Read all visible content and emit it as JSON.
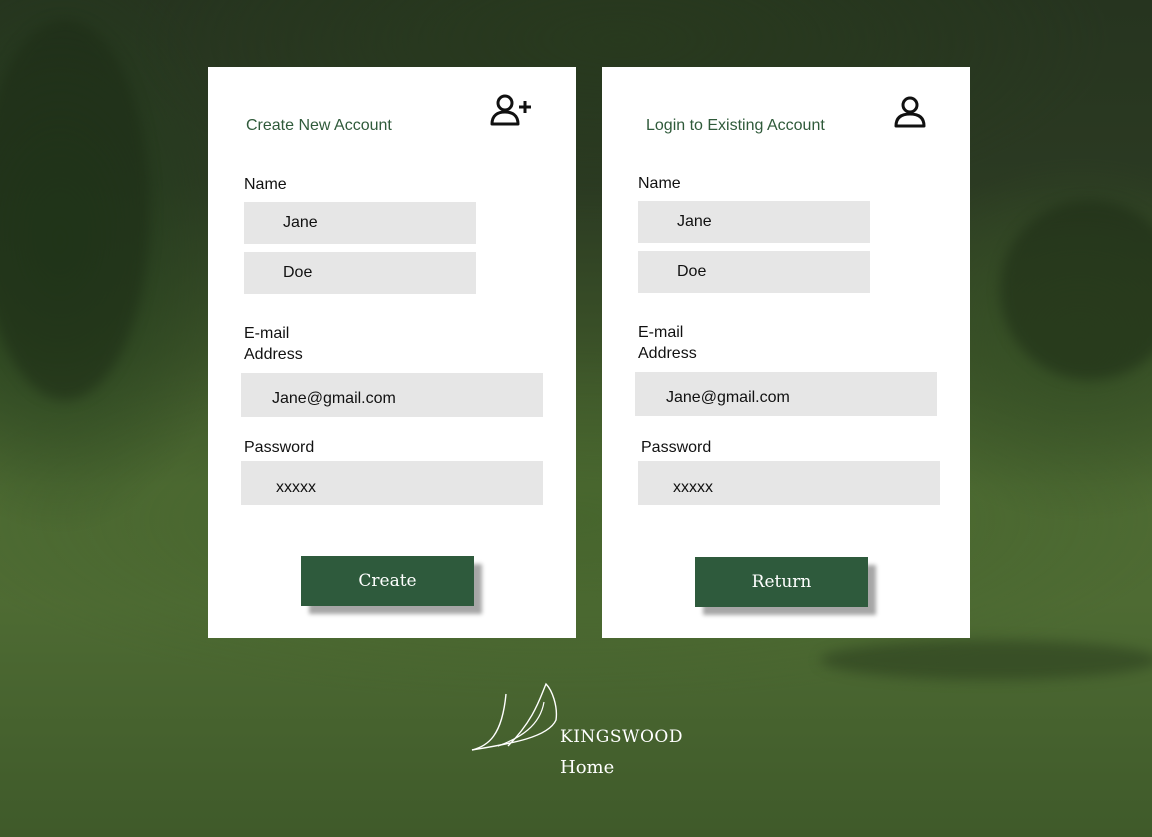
{
  "create_card": {
    "title": "Create New Account",
    "icon": "add-user-icon",
    "name_label": "Name",
    "first_name": "Jane",
    "last_name": "Doe",
    "email_label_line1": "E-mail",
    "email_label_line2": "Address",
    "email": "Jane@gmail.com",
    "password_label": "Password",
    "password": "xxxxx",
    "button_label": "Create"
  },
  "login_card": {
    "title": "Login to Existing Account",
    "icon": "user-icon",
    "name_label": "Name",
    "first_name": "Jane",
    "last_name": "Doe",
    "email_label_line1": "E-mail",
    "email_label_line2": "Address",
    "email": "Jane@gmail.com",
    "password_label": "Password",
    "password": "xxxxx",
    "button_label": "Return"
  },
  "footer": {
    "brand": "KINGSWOOD",
    "home_link": "Home"
  },
  "colors": {
    "accent": "#2e5a3c",
    "title_text": "#2f5a3a",
    "field_bg": "#e6e6e6"
  }
}
